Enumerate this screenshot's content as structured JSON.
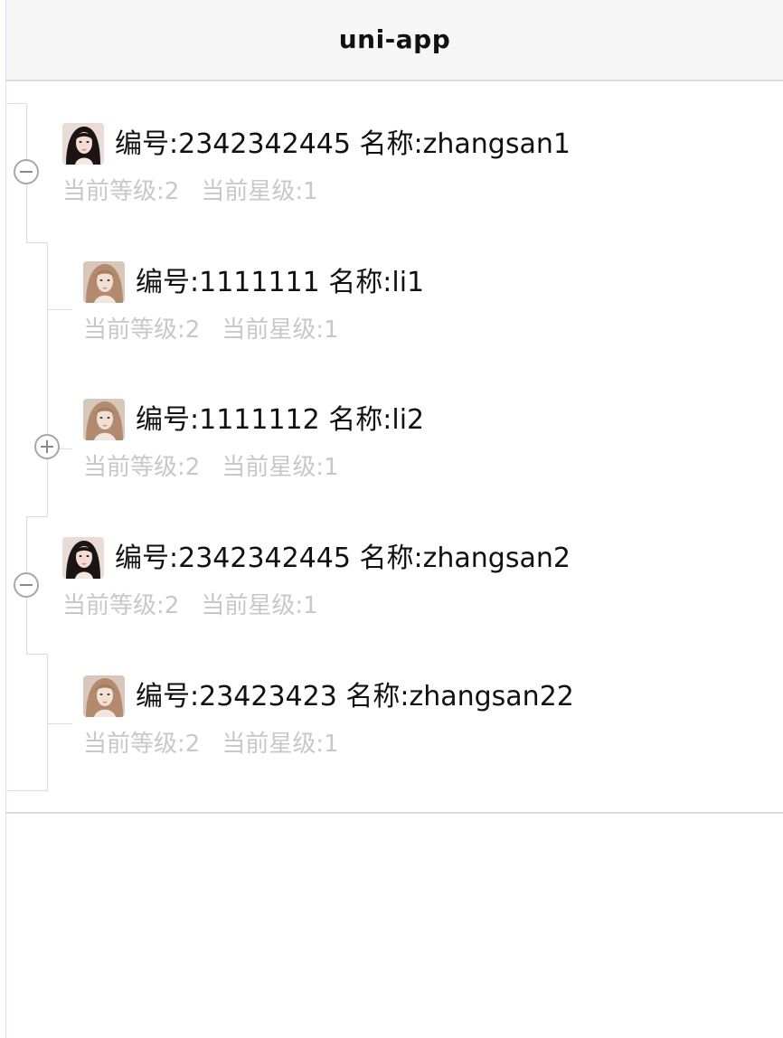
{
  "app": {
    "title": "uni-app"
  },
  "tree": {
    "nodes": [
      {
        "id_label": "编号:2342342445",
        "name_label": "名称:zhangsan1",
        "level_label": "当前等级:2",
        "star_label": "当前星级:1",
        "depth": 0,
        "toggle": "minus",
        "avatar": "portrait-a"
      },
      {
        "id_label": "编号:1111111",
        "name_label": "名称:li1",
        "level_label": "当前等级:2",
        "star_label": "当前星级:1",
        "depth": 1,
        "toggle": "none",
        "avatar": "portrait-b"
      },
      {
        "id_label": "编号:1111112",
        "name_label": "名称:li2",
        "level_label": "当前等级:2",
        "star_label": "当前星级:1",
        "depth": 1,
        "toggle": "plus",
        "avatar": "portrait-b"
      },
      {
        "id_label": "编号:2342342445",
        "name_label": "名称:zhangsan2",
        "level_label": "当前等级:2",
        "star_label": "当前星级:1",
        "depth": 0,
        "toggle": "minus",
        "avatar": "portrait-a"
      },
      {
        "id_label": "编号:23423423",
        "name_label": "名称:zhangsan22",
        "level_label": "当前等级:2",
        "star_label": "当前星级:1",
        "depth": 1,
        "toggle": "none",
        "avatar": "portrait-b"
      }
    ]
  },
  "icons": {
    "collapse": "minus-circle-icon",
    "expand": "plus-circle-icon"
  },
  "colors": {
    "text": "#111111",
    "sub_text": "#c8c8c8",
    "tree_line": "#dddddd",
    "navbar_bg": "#f7f7f7"
  }
}
